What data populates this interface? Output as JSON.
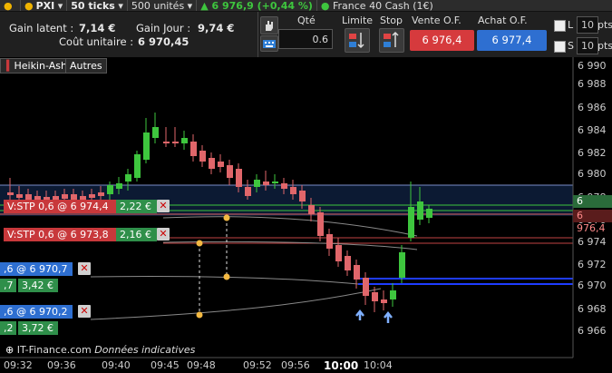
{
  "topbar": {
    "account": "PXI",
    "ticks": "50 ticks",
    "units": "500 unités",
    "price_change": "6 976,9 (+0,44 %)",
    "instrument": "France 40 Cash (1€)"
  },
  "info": {
    "gain_latent_label": "Gain latent :",
    "gain_latent_value": "7,14 €",
    "gain_jour_label": "Gain Jour :",
    "gain_jour_value": "9,74 €",
    "cout_label": "Coût unitaire :",
    "cout_value": "6 970,45",
    "qte_label": "Qté",
    "qte_value": "0.6",
    "limite_label": "Limite",
    "stop_label": "Stop",
    "vente_label": "Vente O.F.",
    "achat_label": "Achat O.F.",
    "vente_price": "6 976,4",
    "achat_price": "6 977,4",
    "l_label": "L",
    "s_label": "S",
    "l_pts": "10",
    "s_pts": "10",
    "pts": "pts"
  },
  "chart_menu": {
    "heikin": "Heikin-Ashi",
    "autres": "Autres"
  },
  "orders": [
    {
      "label": "V:STP  0,6 @ 6 974,4",
      "gain": "2,22 €"
    },
    {
      "label": "V:STP  0,6 @ 6 973,8",
      "gain": "2,16 €"
    },
    {
      "label": ",6 @ 6 970,7",
      "gain": "3,42 €",
      "gain_prefix": ",7"
    },
    {
      "label": ",6 @ 6 970,2",
      "gain": "3,72 €",
      "gain_prefix": ",2"
    }
  ],
  "axis": {
    "y_labels": [
      "6 990",
      "6 988",
      "6 986",
      "6 984",
      "6 982",
      "6 980",
      "6 978",
      "6 976",
      "6 974",
      "6 972",
      "6 970",
      "6 968",
      "6 966"
    ],
    "price_tag_green": "6 977,4",
    "price_tag_red": "6 976,4",
    "x_labels": [
      "09:32",
      "09:36",
      "09:40",
      "09:45",
      "09:48",
      "09:52",
      "09:56",
      "10:00",
      "10:04"
    ]
  },
  "footer": {
    "brand": "IT-Finance.com",
    "note": "Données indicatives"
  },
  "colors": {
    "bull": "#3ec63e",
    "bear": "#e0666a",
    "accent_blue": "#2e6fd1",
    "sell": "#d63a3d"
  }
}
